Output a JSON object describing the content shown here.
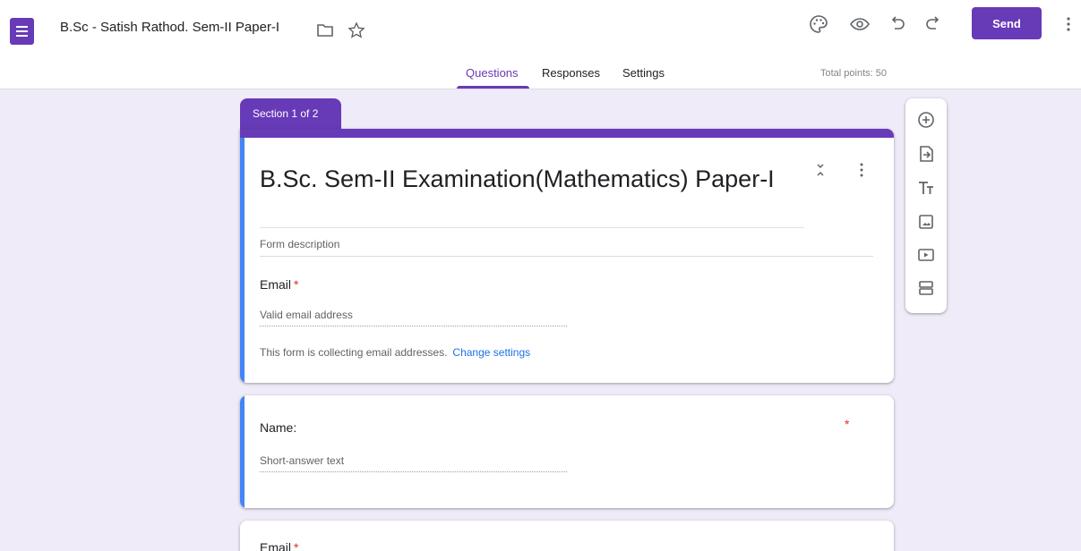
{
  "header": {
    "doc_title": "B.Sc - Satish Rathod. Sem-II Paper-I",
    "send_label": "Send",
    "icons": [
      "palette-icon",
      "eye-icon",
      "undo-icon",
      "redo-icon",
      "more-vert-icon",
      "folder-icon",
      "star-icon"
    ]
  },
  "tabs": {
    "questions": "Questions",
    "responses": "Responses",
    "settings": "Settings",
    "total_points": "Total points: 50"
  },
  "section": {
    "label": "Section 1 of 2"
  },
  "form": {
    "title": "B.Sc. Sem-II Examination(Mathematics) Paper-I",
    "description_placeholder": "Form description",
    "email_label": "Email",
    "email_placeholder": "Valid email address",
    "collect_text": "This form is collecting email addresses.",
    "change_settings": "Change settings"
  },
  "questions": [
    {
      "label": "Name:",
      "required": "*",
      "placeholder": "Short-answer text"
    },
    {
      "label": "Email",
      "required": "*"
    }
  ],
  "colors": {
    "accent": "#673ab7",
    "focus": "#4285f4",
    "background": "#f0ebf8",
    "required": "#d93025",
    "link": "#1a73e8"
  }
}
